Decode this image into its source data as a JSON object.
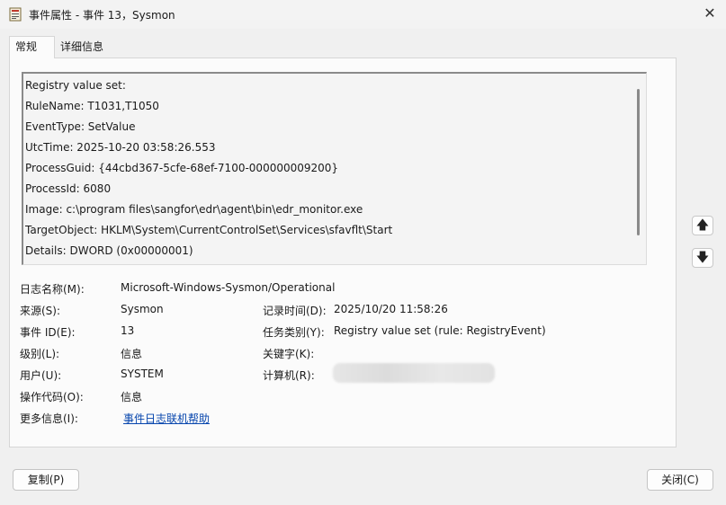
{
  "window": {
    "title": "事件属性 - 事件 13，Sysmon",
    "close_glyph": "✕"
  },
  "tabs": [
    {
      "label": "常规"
    },
    {
      "label": "详细信息"
    }
  ],
  "description_lines": [
    "Registry value set:",
    "RuleName: T1031,T1050",
    "EventType: SetValue",
    "UtcTime: 2025-10-20 03:58:26.553",
    "ProcessGuid: {44cbd367-5cfe-68ef-7100-000000009200}",
    "ProcessId: 6080",
    "Image: c:\\program files\\sangfor\\edr\\agent\\bin\\edr_monitor.exe",
    "TargetObject: HKLM\\System\\CurrentControlSet\\Services\\sfavflt\\Start",
    "Details: DWORD (0x00000001)"
  ],
  "nav": {
    "up_glyph": "🡅",
    "down_glyph": "🡇"
  },
  "fields": {
    "log_name_label": "日志名称(M):",
    "log_name_value": "Microsoft-Windows-Sysmon/Operational",
    "source_label": "来源(S):",
    "source_value": "Sysmon",
    "logged_label": "记录时间(D):",
    "logged_value": "2025/10/20 11:58:26",
    "event_id_label": "事件 ID(E):",
    "event_id_value": "13",
    "task_label": "任务类别(Y):",
    "task_value": "Registry value set (rule: RegistryEvent)",
    "level_label": "级别(L):",
    "level_value": "信息",
    "keywords_label": "关键字(K):",
    "keywords_value": "",
    "user_label": "用户(U):",
    "user_value": "SYSTEM",
    "computer_label": "计算机(R):",
    "opcode_label": "操作代码(O):",
    "opcode_value": "信息",
    "more_info_label": "更多信息(I):",
    "more_info_link": "事件日志联机帮助"
  },
  "buttons": {
    "copy": "复制(P)",
    "close": "关闭(C)"
  }
}
